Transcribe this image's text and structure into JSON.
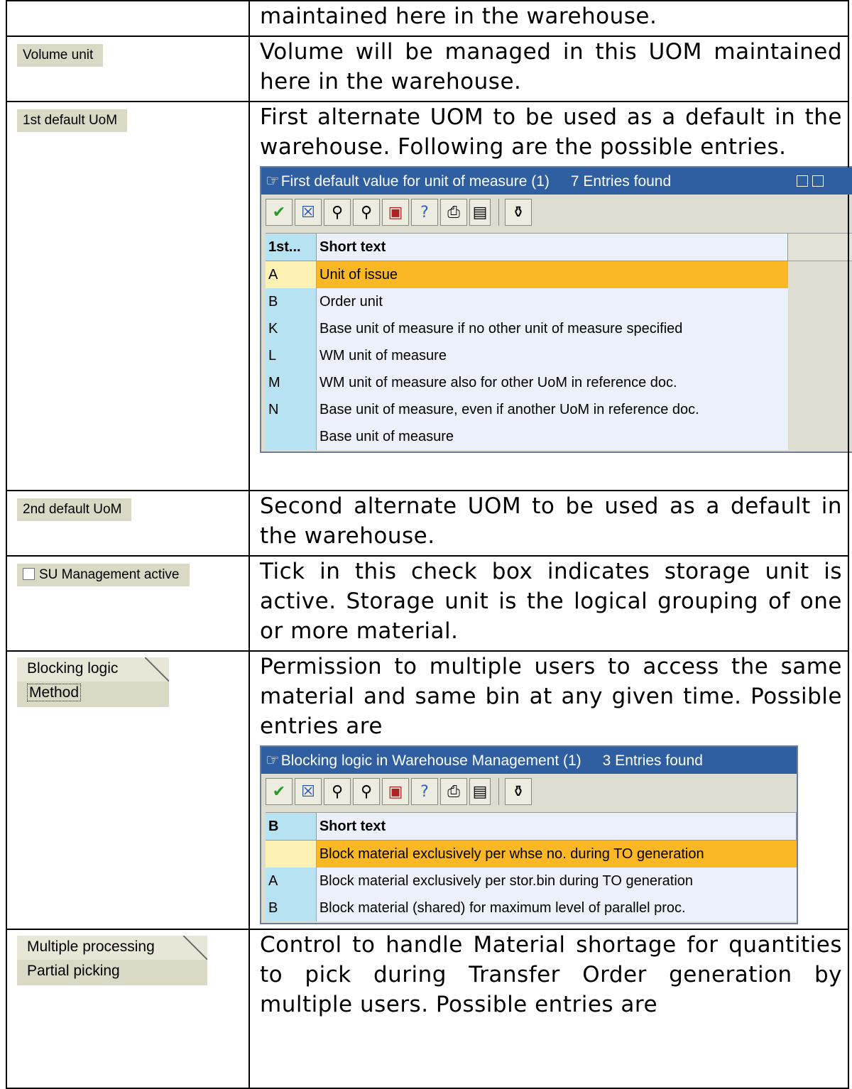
{
  "rows": [
    {
      "field": "",
      "desc": "maintained here in the warehouse."
    },
    {
      "field": "Volume unit",
      "desc": "Volume will be managed in this UOM maintained here in the warehouse."
    },
    {
      "field": "1st default UoM",
      "desc": "First alternate UOM to be used as a default in the warehouse. Following are the possible entries."
    },
    {
      "field": "2nd default UoM",
      "desc": "Second alternate UOM to be used as a default in the warehouse."
    },
    {
      "field": "SU Management active",
      "desc": "Tick in this check box indicates storage unit is active. Storage unit is the logical grouping of one or more material."
    },
    {
      "field_tab": "Blocking logic",
      "field_sub": "Method",
      "desc": "Permission to multiple users to access the same material and same bin at any given time. Possible entries are"
    },
    {
      "field_tab": "Multiple processing",
      "field_sub": "Partial picking",
      "desc": "Control to handle Material shortage for quantities to pick during Transfer Order generation by multiple users. Possible entries are"
    }
  ],
  "popup1": {
    "title": "First default value for unit of measure (1)",
    "count": "7 Entries found",
    "col1": "1st...",
    "col2": "Short text",
    "entries": [
      {
        "key": "A",
        "text": "Unit of issue"
      },
      {
        "key": "B",
        "text": "Order unit"
      },
      {
        "key": "K",
        "text": "Base unit of measure if no other unit of measure specified"
      },
      {
        "key": "L",
        "text": "WM unit of measure"
      },
      {
        "key": "M",
        "text": "WM unit of measure also for other UoM in reference doc."
      },
      {
        "key": "N",
        "text": "Base unit of measure, even if another UoM in reference doc."
      },
      {
        "key": "",
        "text": "Base unit of measure"
      }
    ]
  },
  "popup2": {
    "title": "Blocking logic in Warehouse Management (1)",
    "count": "3 Entries found",
    "col1": "B",
    "col2": "Short text",
    "entries": [
      {
        "key": "",
        "text": "Block material exclusively per whse no. during TO generation"
      },
      {
        "key": "A",
        "text": "Block material exclusively per stor.bin during TO generation"
      },
      {
        "key": "B",
        "text": "Block material (shared) for maximum level of parallel proc."
      }
    ]
  },
  "colors": {
    "title_bar": "#2f5fa0",
    "selected_row": "#fbb724",
    "key_col": "#b7e2f2",
    "field_bg": "#d9d9c5"
  },
  "toolbar_icons": [
    "check-icon",
    "cancel-icon",
    "find-icon",
    "find-next-icon",
    "insert-icon",
    "help-icon",
    "print-icon",
    "print-preview-icon",
    "local-menu-icon"
  ]
}
